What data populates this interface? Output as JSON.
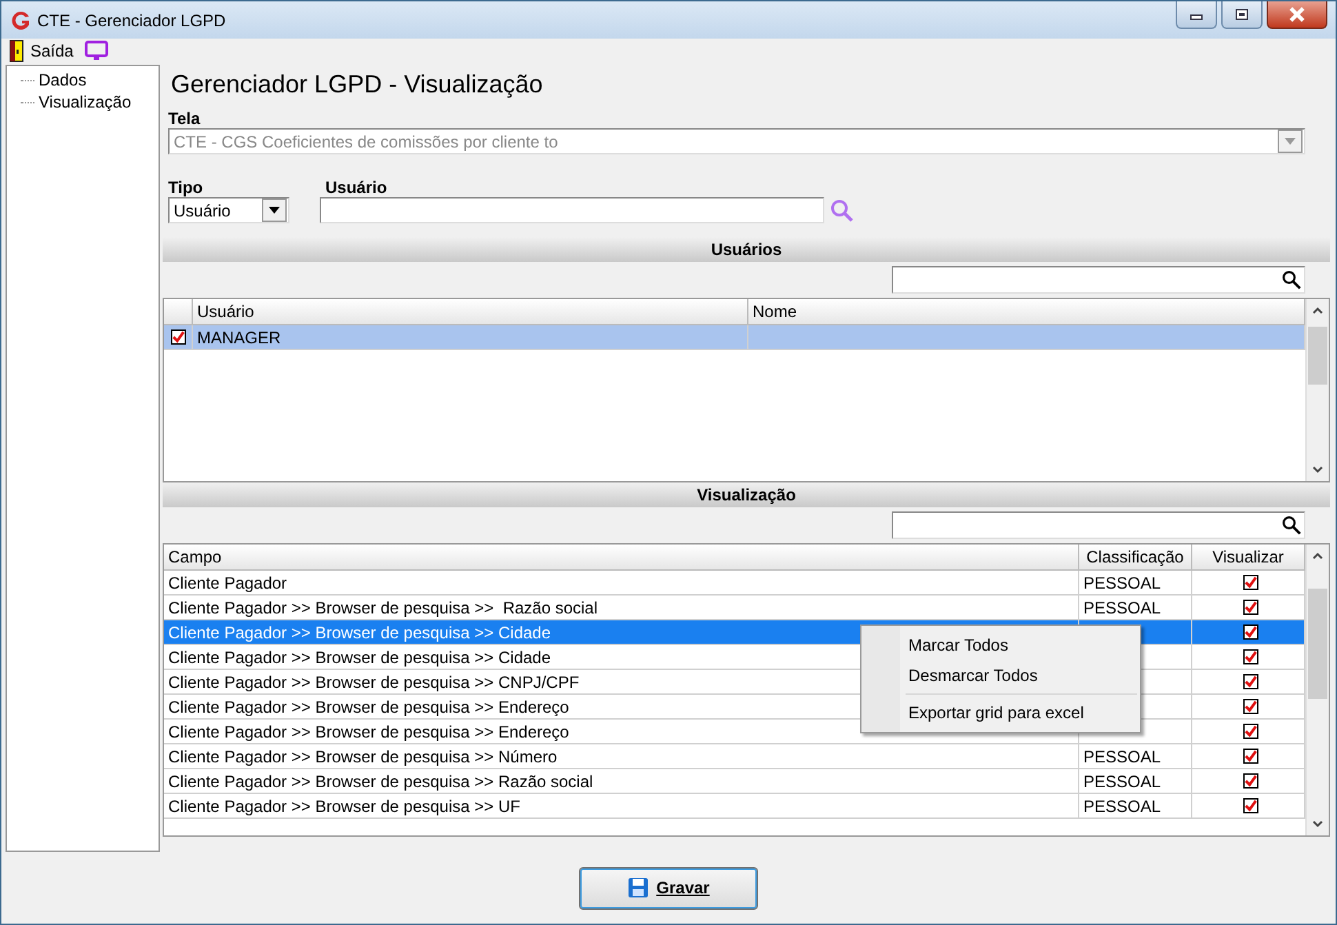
{
  "window": {
    "title": "CTE - Gerenciador LGPD"
  },
  "toolbar": {
    "exit_label": "Saída"
  },
  "tree": [
    {
      "label": "Dados"
    },
    {
      "label": "Visualização"
    }
  ],
  "heading": "Gerenciador LGPD - Visualização",
  "tela": {
    "label": "Tela",
    "value": "CTE - CGS Coeficientes de comissões por cliente to",
    "disabled": true
  },
  "tipo": {
    "label": "Tipo",
    "value": "Usuário"
  },
  "usuario": {
    "label": "Usuário"
  },
  "users_section": {
    "title": "Usuários",
    "columns": [
      "Usuário",
      "Nome"
    ],
    "rows": [
      {
        "checked": true,
        "selected": true,
        "usuario": "MANAGER"
      }
    ]
  },
  "view_section": {
    "title": "Visualização",
    "columns": [
      "Campo",
      "Classificação",
      "Visualizar"
    ],
    "rows": [
      {
        "campo": "Cliente Pagador",
        "classificacao": "PESSOAL",
        "visualizar": true,
        "selected": false
      },
      {
        "campo": "Cliente Pagador >> Browser de pesquisa >>  Razão social",
        "classificacao": "PESSOAL",
        "visualizar": true,
        "selected": false
      },
      {
        "campo": "Cliente Pagador >> Browser de pesquisa >> Cidade",
        "visualizar": true,
        "selected": true
      },
      {
        "campo": "Cliente Pagador >> Browser de pesquisa >> Cidade",
        "visualizar": true,
        "selected": false
      },
      {
        "campo": "Cliente Pagador >> Browser de pesquisa >> CNPJ/CPF",
        "visualizar": true,
        "selected": false
      },
      {
        "campo": "Cliente Pagador >> Browser de pesquisa >> Endereço",
        "visualizar": true,
        "selected": false
      },
      {
        "campo": "Cliente Pagador >> Browser de pesquisa >> Endereço",
        "visualizar": true,
        "selected": false
      },
      {
        "campo": "Cliente Pagador >> Browser de pesquisa >> Número",
        "classificacao": "PESSOAL",
        "visualizar": true,
        "selected": false
      },
      {
        "campo": "Cliente Pagador >> Browser de pesquisa >> Razão social",
        "classificacao": "PESSOAL",
        "visualizar": true,
        "selected": false
      },
      {
        "campo": "Cliente Pagador >> Browser de pesquisa >> UF",
        "classificacao": "PESSOAL",
        "visualizar": true,
        "selected": false
      }
    ]
  },
  "context_menu": {
    "groups": [
      [
        "Marcar Todos",
        "Desmarcar Todos"
      ],
      [
        "Exportar grid para excel"
      ]
    ]
  },
  "save_button": {
    "label": "Gravar"
  }
}
